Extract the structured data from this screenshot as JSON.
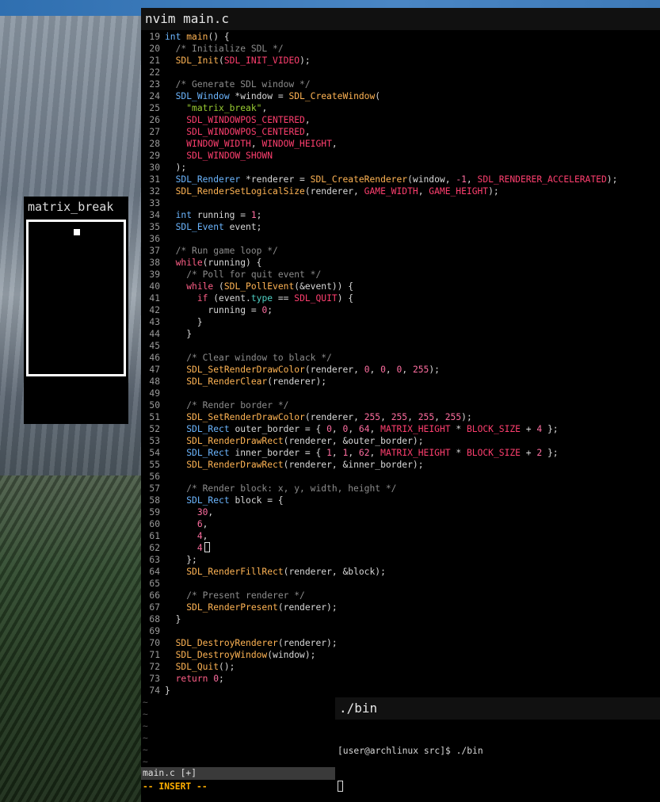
{
  "game": {
    "title": "matrix_break"
  },
  "nvim": {
    "title": "nvim main.c",
    "statusline": "main.c [+]",
    "mode": "-- INSERT --",
    "lines": [
      {
        "n": "19",
        "t": [
          [
            "int",
            "ty"
          ],
          [
            " "
          ],
          [
            "main",
            "fn"
          ],
          [
            "() {"
          ]
        ]
      },
      {
        "n": "20",
        "t": [
          [
            "  "
          ],
          [
            "/* Initialize SDL */",
            "cm"
          ]
        ]
      },
      {
        "n": "21",
        "t": [
          [
            "  "
          ],
          [
            "SDL_Init",
            "fn"
          ],
          [
            "("
          ],
          [
            "SDL_INIT_VIDEO",
            "co"
          ],
          [
            ");"
          ]
        ]
      },
      {
        "n": "22",
        "t": []
      },
      {
        "n": "23",
        "t": [
          [
            "  "
          ],
          [
            "/* Generate SDL window */",
            "cm"
          ]
        ]
      },
      {
        "n": "24",
        "t": [
          [
            "  "
          ],
          [
            "SDL_Window",
            "ty"
          ],
          [
            " *window = "
          ],
          [
            "SDL_CreateWindow",
            "fn"
          ],
          [
            "("
          ]
        ]
      },
      {
        "n": "25",
        "t": [
          [
            "    "
          ],
          [
            "\"matrix_break\"",
            "st"
          ],
          [
            ","
          ]
        ]
      },
      {
        "n": "26",
        "t": [
          [
            "    "
          ],
          [
            "SDL_WINDOWPOS_CENTERED",
            "co"
          ],
          [
            ","
          ]
        ]
      },
      {
        "n": "27",
        "t": [
          [
            "    "
          ],
          [
            "SDL_WINDOWPOS_CENTERED",
            "co"
          ],
          [
            ","
          ]
        ]
      },
      {
        "n": "28",
        "t": [
          [
            "    "
          ],
          [
            "WINDOW_WIDTH",
            "co"
          ],
          [
            ", "
          ],
          [
            "WINDOW_HEIGHT",
            "co"
          ],
          [
            ","
          ]
        ]
      },
      {
        "n": "29",
        "t": [
          [
            "    "
          ],
          [
            "SDL_WINDOW_SHOWN",
            "co"
          ]
        ]
      },
      {
        "n": "30",
        "t": [
          [
            "  );"
          ]
        ]
      },
      {
        "n": "31",
        "t": [
          [
            "  "
          ],
          [
            "SDL_Renderer",
            "ty"
          ],
          [
            " *renderer = "
          ],
          [
            "SDL_CreateRenderer",
            "fn"
          ],
          [
            "(window, "
          ],
          [
            "-1",
            "nu"
          ],
          [
            ", "
          ],
          [
            "SDL_RENDERER_ACCELERATED",
            "co"
          ],
          [
            ");"
          ]
        ]
      },
      {
        "n": "32",
        "t": [
          [
            "  "
          ],
          [
            "SDL_RenderSetLogicalSize",
            "fn"
          ],
          [
            "(renderer, "
          ],
          [
            "GAME_WIDTH",
            "co"
          ],
          [
            ", "
          ],
          [
            "GAME_HEIGHT",
            "co"
          ],
          [
            ");"
          ]
        ]
      },
      {
        "n": "33",
        "t": []
      },
      {
        "n": "34",
        "t": [
          [
            "  "
          ],
          [
            "int",
            "ty"
          ],
          [
            " running = "
          ],
          [
            "1",
            "nu"
          ],
          [
            ";"
          ]
        ]
      },
      {
        "n": "35",
        "t": [
          [
            "  "
          ],
          [
            "SDL_Event",
            "ty"
          ],
          [
            " event;"
          ]
        ]
      },
      {
        "n": "36",
        "t": []
      },
      {
        "n": "37",
        "t": [
          [
            "  "
          ],
          [
            "/* Run game loop */",
            "cm"
          ]
        ]
      },
      {
        "n": "38",
        "t": [
          [
            "  "
          ],
          [
            "while",
            "kw"
          ],
          [
            "(running) {"
          ]
        ]
      },
      {
        "n": "39",
        "t": [
          [
            "    "
          ],
          [
            "/* Poll for quit event */",
            "cm"
          ]
        ]
      },
      {
        "n": "40",
        "t": [
          [
            "    "
          ],
          [
            "while",
            "kw"
          ],
          [
            " ("
          ],
          [
            "SDL_PollEvent",
            "fn"
          ],
          [
            "(&event)) {"
          ]
        ]
      },
      {
        "n": "41",
        "t": [
          [
            "      "
          ],
          [
            "if",
            "kw"
          ],
          [
            " (event."
          ],
          [
            "type",
            "fld"
          ],
          [
            " == "
          ],
          [
            "SDL_QUIT",
            "co"
          ],
          [
            ") {"
          ]
        ]
      },
      {
        "n": "42",
        "t": [
          [
            "        running = "
          ],
          [
            "0",
            "nu"
          ],
          [
            ";"
          ]
        ]
      },
      {
        "n": "43",
        "t": [
          [
            "      }"
          ]
        ]
      },
      {
        "n": "44",
        "t": [
          [
            "    }"
          ]
        ]
      },
      {
        "n": "45",
        "t": []
      },
      {
        "n": "46",
        "t": [
          [
            "    "
          ],
          [
            "/* Clear window to black */",
            "cm"
          ]
        ]
      },
      {
        "n": "47",
        "t": [
          [
            "    "
          ],
          [
            "SDL_SetRenderDrawColor",
            "fn"
          ],
          [
            "(renderer, "
          ],
          [
            "0",
            "nu"
          ],
          [
            ", "
          ],
          [
            "0",
            "nu"
          ],
          [
            ", "
          ],
          [
            "0",
            "nu"
          ],
          [
            ", "
          ],
          [
            "255",
            "nu"
          ],
          [
            ");"
          ]
        ]
      },
      {
        "n": "48",
        "t": [
          [
            "    "
          ],
          [
            "SDL_RenderClear",
            "fn"
          ],
          [
            "(renderer);"
          ]
        ]
      },
      {
        "n": "49",
        "t": []
      },
      {
        "n": "50",
        "t": [
          [
            "    "
          ],
          [
            "/* Render border */",
            "cm"
          ]
        ]
      },
      {
        "n": "51",
        "t": [
          [
            "    "
          ],
          [
            "SDL_SetRenderDrawColor",
            "fn"
          ],
          [
            "(renderer, "
          ],
          [
            "255",
            "nu"
          ],
          [
            ", "
          ],
          [
            "255",
            "nu"
          ],
          [
            ", "
          ],
          [
            "255",
            "nu"
          ],
          [
            ", "
          ],
          [
            "255",
            "nu"
          ],
          [
            ");"
          ]
        ]
      },
      {
        "n": "52",
        "t": [
          [
            "    "
          ],
          [
            "SDL_Rect",
            "ty"
          ],
          [
            " outer_border = { "
          ],
          [
            "0",
            "nu"
          ],
          [
            ", "
          ],
          [
            "0",
            "nu"
          ],
          [
            ", "
          ],
          [
            "64",
            "nu"
          ],
          [
            ", "
          ],
          [
            "MATRIX_HEIGHT",
            "co"
          ],
          [
            " * "
          ],
          [
            "BLOCK_SIZE",
            "co"
          ],
          [
            " + "
          ],
          [
            "4",
            "nu"
          ],
          [
            " };"
          ]
        ]
      },
      {
        "n": "53",
        "t": [
          [
            "    "
          ],
          [
            "SDL_RenderDrawRect",
            "fn"
          ],
          [
            "(renderer, &outer_border);"
          ]
        ]
      },
      {
        "n": "54",
        "t": [
          [
            "    "
          ],
          [
            "SDL_Rect",
            "ty"
          ],
          [
            " inner_border = { "
          ],
          [
            "1",
            "nu"
          ],
          [
            ", "
          ],
          [
            "1",
            "nu"
          ],
          [
            ", "
          ],
          [
            "62",
            "nu"
          ],
          [
            ", "
          ],
          [
            "MATRIX_HEIGHT",
            "co"
          ],
          [
            " * "
          ],
          [
            "BLOCK_SIZE",
            "co"
          ],
          [
            " + "
          ],
          [
            "2",
            "nu"
          ],
          [
            " };"
          ]
        ]
      },
      {
        "n": "55",
        "t": [
          [
            "    "
          ],
          [
            "SDL_RenderDrawRect",
            "fn"
          ],
          [
            "(renderer, &inner_border);"
          ]
        ]
      },
      {
        "n": "56",
        "t": []
      },
      {
        "n": "57",
        "t": [
          [
            "    "
          ],
          [
            "/* Render block: x, y, width, height */",
            "cm"
          ]
        ]
      },
      {
        "n": "58",
        "t": [
          [
            "    "
          ],
          [
            "SDL_Rect",
            "ty"
          ],
          [
            " block = {"
          ]
        ]
      },
      {
        "n": "59",
        "t": [
          [
            "      "
          ],
          [
            "30",
            "nu"
          ],
          [
            ","
          ]
        ]
      },
      {
        "n": "60",
        "t": [
          [
            "      "
          ],
          [
            "6",
            "nu"
          ],
          [
            ","
          ]
        ]
      },
      {
        "n": "61",
        "t": [
          [
            "      "
          ],
          [
            "4",
            "nu"
          ],
          [
            ","
          ]
        ]
      },
      {
        "n": "62",
        "t": [
          [
            "      "
          ],
          [
            "4",
            "nu"
          ]
        ],
        "cursor": true
      },
      {
        "n": "63",
        "t": [
          [
            "    };"
          ]
        ]
      },
      {
        "n": "64",
        "t": [
          [
            "    "
          ],
          [
            "SDL_RenderFillRect",
            "fn"
          ],
          [
            "(renderer, &block);"
          ]
        ]
      },
      {
        "n": "65",
        "t": []
      },
      {
        "n": "66",
        "t": [
          [
            "    "
          ],
          [
            "/* Present renderer */",
            "cm"
          ]
        ]
      },
      {
        "n": "67",
        "t": [
          [
            "    "
          ],
          [
            "SDL_RenderPresent",
            "fn"
          ],
          [
            "(renderer);"
          ]
        ]
      },
      {
        "n": "68",
        "t": [
          [
            "  }"
          ]
        ]
      },
      {
        "n": "69",
        "t": []
      },
      {
        "n": "70",
        "t": [
          [
            "  "
          ],
          [
            "SDL_DestroyRenderer",
            "fn"
          ],
          [
            "(renderer);"
          ]
        ]
      },
      {
        "n": "71",
        "t": [
          [
            "  "
          ],
          [
            "SDL_DestroyWindow",
            "fn"
          ],
          [
            "(window);"
          ]
        ]
      },
      {
        "n": "72",
        "t": [
          [
            "  "
          ],
          [
            "SDL_Quit",
            "fn"
          ],
          [
            "();"
          ]
        ]
      },
      {
        "n": "73",
        "t": [
          [
            "  "
          ],
          [
            "return",
            "kw"
          ],
          [
            " "
          ],
          [
            "0",
            "nu"
          ],
          [
            ";"
          ]
        ]
      },
      {
        "n": "74",
        "t": [
          [
            "}"
          ]
        ]
      }
    ],
    "tildes": [
      "~",
      "~",
      "~",
      "~",
      "~",
      "~"
    ]
  },
  "bin": {
    "title": "./bin",
    "prompt": "[user@archlinux src]$ ./bin"
  }
}
